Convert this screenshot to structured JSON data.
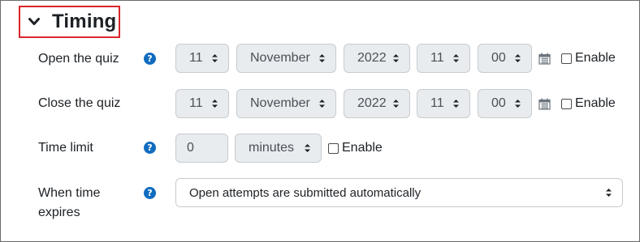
{
  "section": {
    "title": "Timing"
  },
  "open_quiz": {
    "label": "Open the quiz",
    "day": "11",
    "month": "November",
    "year": "2022",
    "hour": "11",
    "minute": "00",
    "enable_label": "Enable"
  },
  "close_quiz": {
    "label": "Close the quiz",
    "day": "11",
    "month": "November",
    "year": "2022",
    "hour": "11",
    "minute": "00",
    "enable_label": "Enable"
  },
  "time_limit": {
    "label": "Time limit",
    "value": "0",
    "unit": "minutes",
    "enable_label": "Enable"
  },
  "when_expires": {
    "label_line1": "When time",
    "label_line2": "expires",
    "selected": "Open attempts are submitted automatically"
  },
  "icons": {
    "help": "?",
    "collapse": "chevron-down-icon",
    "calendar": "calendar-icon"
  },
  "colors": {
    "accent": "#0f6cbf",
    "highlight_border": "#d9262c",
    "disabled_bg": "#e9ecef"
  }
}
